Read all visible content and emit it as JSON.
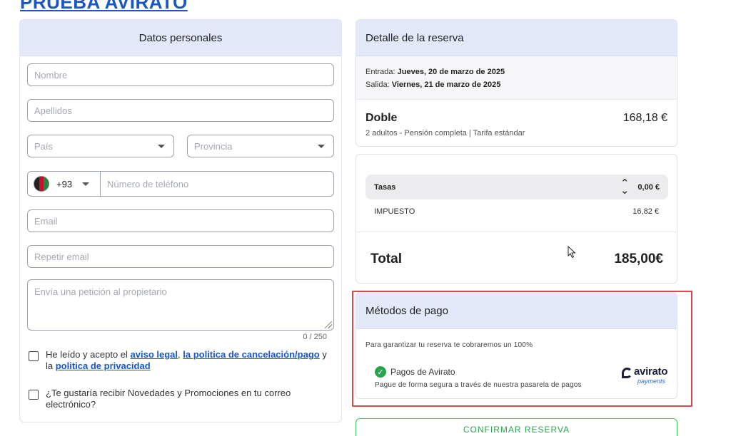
{
  "page_title": "PRUEBA AVIRATO",
  "personal": {
    "header": "Datos personales",
    "nombre_placeholder": "Nombre",
    "apellidos_placeholder": "Apellidos",
    "pais_placeholder": "País",
    "provincia_placeholder": "Provincia",
    "phone_prefix": "+93",
    "phone_placeholder": "Número de teléfono",
    "email_placeholder": "Email",
    "repeat_email_placeholder": "Repetir email",
    "request_placeholder": "Envía una petición al propietario",
    "char_counter": "0 / 250",
    "legal_text_1": "He leído y acepto el ",
    "legal_link_1": "aviso legal",
    "legal_sep": ", ",
    "legal_link_2": "la politica de cancelación/pago",
    "legal_text_2": " y la ",
    "legal_link_3": "politica de privacidad",
    "newsletter_text": "¿Te gustaría recibir Novedades y Promociones en tu correo electrónico?"
  },
  "booking": {
    "header": "Detalle de la reserva",
    "checkin_label": "Entrada: ",
    "checkin_value": "Jueves, 20 de marzo de 2025",
    "checkout_label": "Salida: ",
    "checkout_value": "Viernes, 21 de marzo de 2025",
    "room_name": "Doble",
    "room_price": "168,18 €",
    "room_desc": "2 adultos - Pensión completa | Tarifa estándar"
  },
  "taxes": {
    "label": "Tasas",
    "value": "0,00 €",
    "line_label": "IMPUESTO",
    "line_value": "16,82 €",
    "total_label": "Total",
    "total_value": "185,00€"
  },
  "payment": {
    "header": "Métodos de pago",
    "note": "Para garantizar tu reserva te cobraremos un 100%",
    "method": "Pagos de Avirato",
    "method_desc": "Pague de forma segura a través de nuestra pasarela de pagos",
    "logo_word": "avirato",
    "logo_sub": "payments"
  },
  "confirm_label": "CONFIRMAR RESERVA",
  "colors": {
    "accent_blue": "#1a56c4",
    "header_bg": "#e3e8fb",
    "success_green": "#2aa44f",
    "highlight_red": "#d9484b"
  }
}
